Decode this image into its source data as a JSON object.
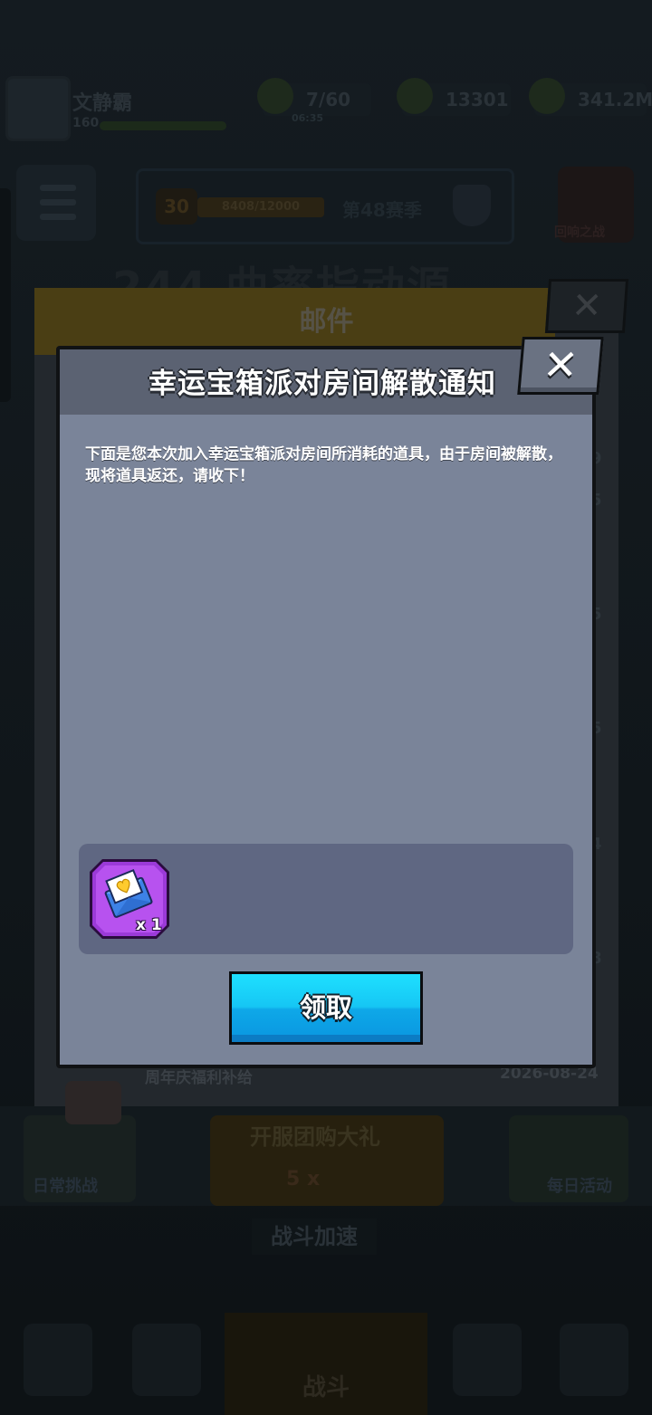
{
  "background": {
    "player": {
      "name": "文静霸",
      "level": "160"
    },
    "resources": [
      {
        "value": "7/60",
        "sub": "06:35",
        "icon": "energy-icon"
      },
      {
        "value": "13301",
        "icon": "gem-icon"
      },
      {
        "value": "341.2M",
        "icon": "coin-icon"
      }
    ],
    "rank": {
      "badge": "30",
      "score": "8408/12000",
      "label": "第48赛季"
    },
    "glory_label": "回响之战",
    "big_title": "244 曲率指动源",
    "mail": {
      "title": "邮件",
      "row_title": "周年庆福利补给",
      "row_date": "2026-08-24"
    },
    "left_activity_label": "日常挑战",
    "center_activity_label": "开服团购大礼",
    "center_activity_sub": "5 x",
    "right_activity_label": "每日活动",
    "speed_label": "战斗加速",
    "nav_battle_label": "战斗",
    "side_marks": [
      "9",
      "5",
      "5",
      "5",
      "4",
      "8"
    ]
  },
  "dialog": {
    "title": "幸运宝箱派对房间解散通知",
    "close_symbol": "✕",
    "body": "下面是您本次加入幸运宝箱派对房间所消耗的道具，由于房间被解散，现将道具返还，请收下！",
    "reward": {
      "item_icon": "heart-letter-icon",
      "quantity": "x 1"
    },
    "claim_label": "领取"
  },
  "colors": {
    "overlay": "#0f1418",
    "dialog_body": "#7a8499",
    "dialog_header": "#5b6272",
    "reward_box": "#5f6782",
    "item_frame": "#9b3ad8",
    "claim_button": "#16c6f4"
  }
}
